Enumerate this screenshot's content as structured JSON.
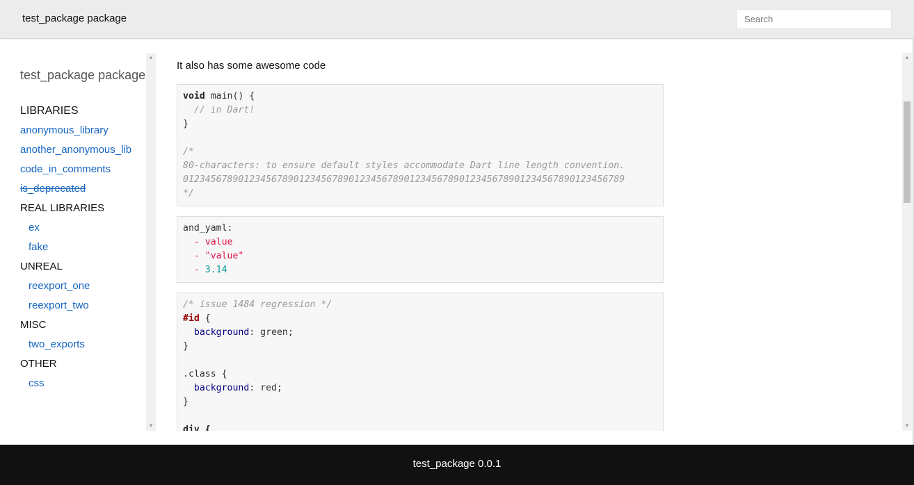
{
  "header": {
    "title": "test_package package",
    "search_placeholder": "Search"
  },
  "sidebar": {
    "package_title": "test_package package",
    "items": [
      {
        "label": "LIBRARIES",
        "kind": "section"
      },
      {
        "label": "anonymous_library",
        "kind": "link"
      },
      {
        "label": "another_anonymous_lib",
        "kind": "link"
      },
      {
        "label": "code_in_comments",
        "kind": "link"
      },
      {
        "label": "is_deprecated",
        "kind": "link",
        "deprecated": true
      },
      {
        "label": "REAL LIBRARIES",
        "kind": "section"
      },
      {
        "label": "ex",
        "kind": "link"
      },
      {
        "label": "fake",
        "kind": "link"
      },
      {
        "label": "UNREAL",
        "kind": "section"
      },
      {
        "label": "reexport_one",
        "kind": "link"
      },
      {
        "label": "reexport_two",
        "kind": "link"
      },
      {
        "label": "MISC",
        "kind": "section"
      },
      {
        "label": "two_exports",
        "kind": "link"
      },
      {
        "label": "OTHER",
        "kind": "section"
      },
      {
        "label": "css",
        "kind": "link"
      }
    ]
  },
  "main": {
    "intro": "It also has some awesome code",
    "dart_block": {
      "kw_void": "void",
      "sig": " main() {",
      "comment": "  // in Dart!",
      "close": "}",
      "c_open": "/*",
      "c_line1": "80-characters: to ensure default styles accommodate Dart line length convention.",
      "c_line2": "01234567890123456789012345678901234567890123456789012345678901234567890123456789",
      "c_close": "*/"
    },
    "yaml_block": {
      "key": "and_yaml:",
      "dash": "  - ",
      "item1": "value",
      "item2": "\"value\"",
      "item3": "3.14"
    },
    "css_block": {
      "comment": "/* issue 1484 regression */",
      "id_sel": "#id",
      "open": " {",
      "prop": "background",
      "val1": ": green;",
      "close": "}",
      "class_sel": ".class {",
      "val2": ": red;",
      "div_sel": "div {"
    }
  },
  "footer": {
    "text": "test_package 0.0.1"
  },
  "colors": {
    "link": "#1565c0",
    "header_bg": "#ececec",
    "footer_bg": "#111111",
    "yaml_string": "#dd1144",
    "yaml_number": "#009999"
  }
}
